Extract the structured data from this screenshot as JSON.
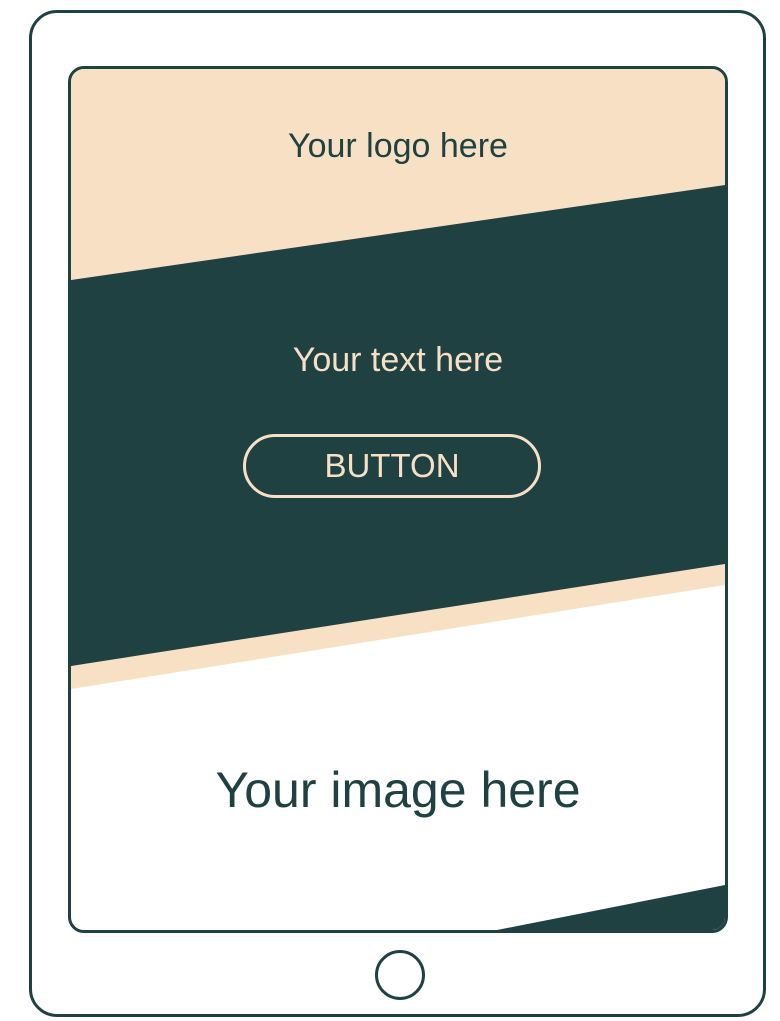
{
  "header": {
    "logo_text": "Your logo here"
  },
  "hero": {
    "text": "Your text here",
    "button_label": "BUTTON"
  },
  "media": {
    "image_text": "Your image here"
  },
  "colors": {
    "dark_teal": "#1f4142",
    "peach": "#f8e0c4",
    "white": "#ffffff"
  },
  "icons": {
    "home_button": "home-button-icon"
  }
}
